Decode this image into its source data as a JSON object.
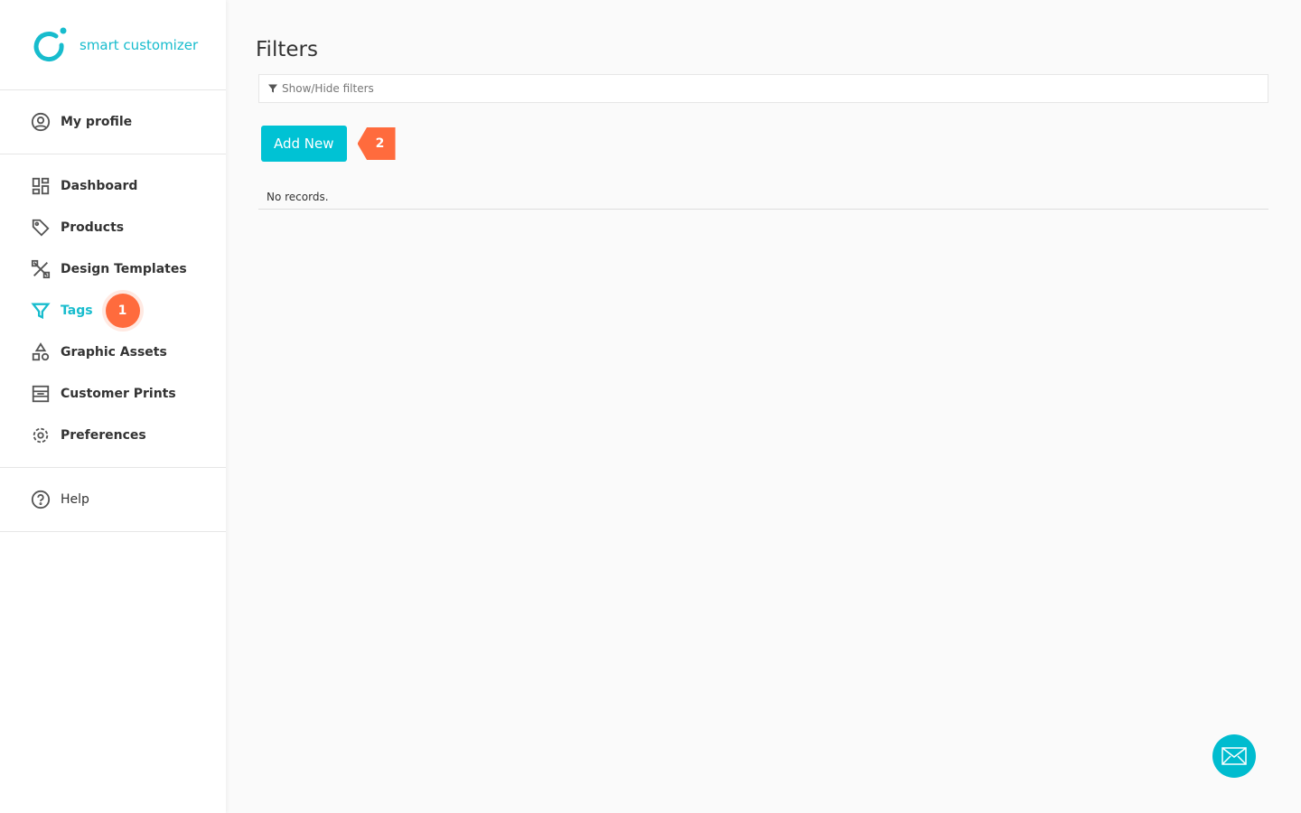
{
  "brand": {
    "name": "smart customizer",
    "color": "#17bccd"
  },
  "sidebar": {
    "profile": {
      "label": "My profile",
      "icon": "user-circle-icon"
    },
    "items": [
      {
        "label": "Dashboard",
        "icon": "dashboard-icon"
      },
      {
        "label": "Products",
        "icon": "tag-icon"
      },
      {
        "label": "Design Templates",
        "icon": "tools-icon"
      },
      {
        "label": "Tags",
        "icon": "filter-icon",
        "active": true,
        "badge": "1"
      },
      {
        "label": "Graphic Assets",
        "icon": "shapes-icon"
      },
      {
        "label": "Customer Prints",
        "icon": "prints-icon"
      },
      {
        "label": "Preferences",
        "icon": "gear-icon"
      }
    ],
    "help": {
      "label": "Help",
      "icon": "question-circle-icon"
    }
  },
  "main": {
    "title": "Filters",
    "filter_toggle": "Show/Hide filters",
    "add_new": "Add New",
    "badge": "2",
    "empty": "No records."
  },
  "colors": {
    "accent": "#00c2d4",
    "badge": "#ff6b3d"
  },
  "chat": {
    "icon": "mail-icon"
  }
}
